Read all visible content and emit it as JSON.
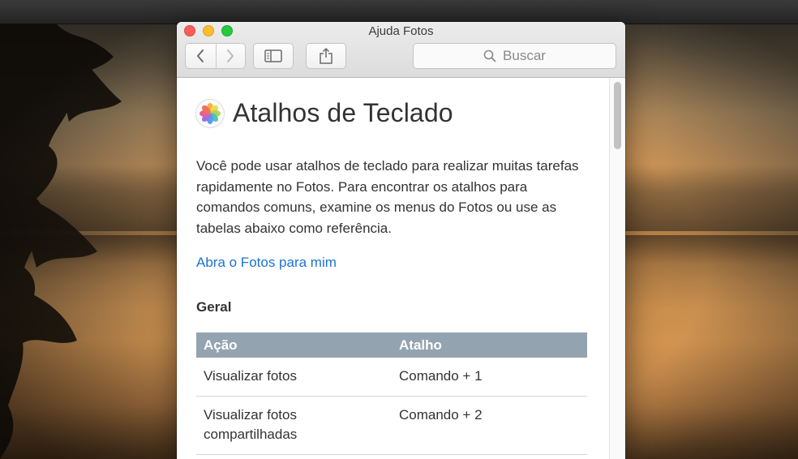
{
  "window": {
    "title": "Ajuda Fotos"
  },
  "toolbar": {
    "back_icon": "chevron-left-icon",
    "forward_icon": "chevron-right-icon",
    "sidebar_icon": "sidebar-icon",
    "share_icon": "share-icon",
    "search_placeholder": "Buscar"
  },
  "page": {
    "title": "Atalhos de Teclado",
    "intro": "Você pode usar atalhos de teclado para realizar muitas tarefas rapidamente no Fotos. Para encontrar os atalhos para comandos comuns, examine os menus do Fotos ou use as tabelas abaixo como referência.",
    "link": "Abra o Fotos para mim",
    "section": "Geral",
    "table": {
      "headers": [
        "Ação",
        "Atalho"
      ],
      "rows": [
        [
          "Visualizar fotos",
          "Comando + 1"
        ],
        [
          "Visualizar fotos compartilhadas",
          "Comando + 2"
        ]
      ]
    }
  },
  "colors": {
    "link": "#1a73d4",
    "table_header": "#94a3b0",
    "close": "#fc5f57",
    "minimize": "#fdbc2e",
    "maximize": "#28c840"
  }
}
